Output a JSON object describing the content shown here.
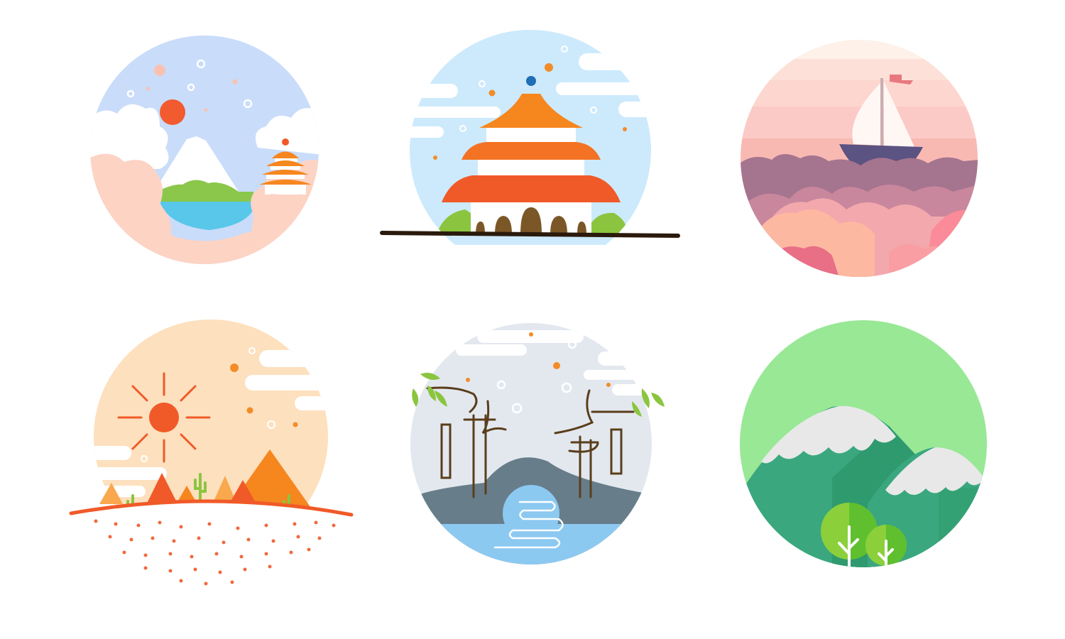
{
  "illustrations": [
    {
      "subject": "fuji-mountain-lake-icon"
    },
    {
      "subject": "temple-of-heaven-icon"
    },
    {
      "subject": "sailboat-on-clouds-icon"
    },
    {
      "subject": "desert-pyramids-icon"
    },
    {
      "subject": "garden-bridge-icon"
    },
    {
      "subject": "snowy-mountains-forest-icon"
    }
  ],
  "palette": {
    "sky_blue": "#c9dcfa",
    "sky_light": "#cdeafc",
    "peach": "#fdd3c4",
    "orange": "#f6861e",
    "red_orange": "#f05a28",
    "pink": "#f9b9b3",
    "purple": "#a1728f",
    "sand": "#fde0be",
    "grey_sky": "#e3e8ef",
    "slate": "#677d8a",
    "water": "#8cc9f1",
    "mint": "#98e895",
    "forest": "#3aa77f",
    "snow": "#e8e8e8",
    "leaf": "#8bc53f",
    "brown": "#5a3e1b"
  }
}
